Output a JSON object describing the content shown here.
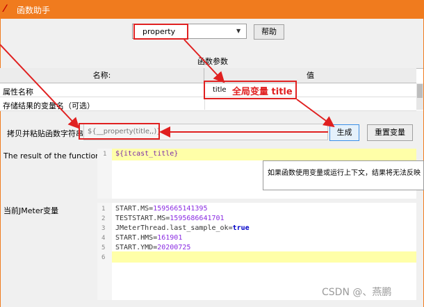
{
  "window": {
    "title": "函数助手"
  },
  "function_select": {
    "value": "property"
  },
  "help_button": {
    "label": "帮助"
  },
  "params": {
    "section_label": "函数参数",
    "col_name": "名称:",
    "col_value": "值",
    "rows": [
      {
        "name": "属性名称",
        "value": "title"
      },
      {
        "name": "存储结果的变量名（可选）",
        "value": ""
      }
    ]
  },
  "annotation": {
    "text": "全局变量 title"
  },
  "copy": {
    "label": "拷贝并粘贴函数字符串",
    "value": "${__property(title,,)}"
  },
  "buttons": {
    "generate": "生成",
    "reset": "重置变量"
  },
  "result": {
    "label": "The result of the function is",
    "line_no": "1",
    "code": "${itcast_title}",
    "tooltip": "如果函数使用变量或运行上下文，结果将无法反映"
  },
  "jmeter_vars": {
    "label": "当前JMeter变量",
    "lines": [
      {
        "n": "1",
        "k": "START.MS",
        "v": "1595665141395"
      },
      {
        "n": "2",
        "k": "TESTSTART.MS",
        "v": "1595686641701"
      },
      {
        "n": "3",
        "k": "JMeterThread.last_sample_ok",
        "v": "true"
      },
      {
        "n": "4",
        "k": "START.HMS",
        "v": "161901"
      },
      {
        "n": "5",
        "k": "START.YMD",
        "v": "20200725"
      },
      {
        "n": "6",
        "k": "",
        "v": ""
      }
    ]
  },
  "watermark": "CSDN @、燕鹏",
  "colors": {
    "titlebar": "#f07b1e",
    "annotation": "#e02020",
    "highlight_line": "#ffffa8"
  }
}
